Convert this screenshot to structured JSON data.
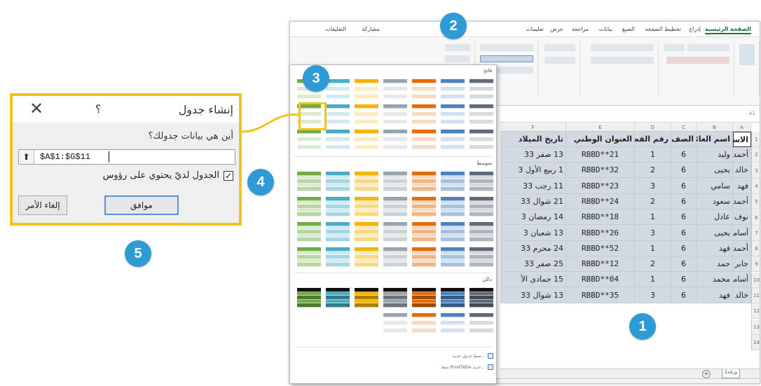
{
  "ribbon": {
    "tabs": [
      "الصفحة الرئيسية",
      "إدراج",
      "تخطيط الصفحة",
      "الصيغ",
      "بيانات",
      "مراجعة",
      "عرض",
      "تعليمات",
      "مشاركة",
      "التعليقات"
    ]
  },
  "sheet": {
    "columns": [
      "A",
      "B",
      "C",
      "D",
      "E",
      "F"
    ],
    "headers": [
      "الاسم",
      "اسم العائلة",
      "الصف",
      "رقم الفصل",
      "العنوان الوطني",
      "تاريخ الميلاد"
    ],
    "rows": [
      [
        "أحمد",
        "وليد",
        "6",
        "1",
        "RBBD**21",
        "13 صفر 33"
      ],
      [
        "خالد",
        "يحيى",
        "6",
        "2",
        "RBBD**32",
        "1 ربيع الأول 3"
      ],
      [
        "فهد",
        "سامي",
        "6",
        "3",
        "RBBD**23",
        "11 رجب 33"
      ],
      [
        "أحمد",
        "سعود",
        "6",
        "2",
        "RBBD**24",
        "21 شوال 33"
      ],
      [
        "نوف",
        "عادل",
        "6",
        "1",
        "RBBD**18",
        "14 رمضان 3"
      ],
      [
        "أسامة",
        "يحيى",
        "6",
        "3",
        "RBBD**26",
        "13 شعبان 3"
      ],
      [
        "أحمد",
        "فهد",
        "6",
        "1",
        "RBBD**52",
        "24 محرم 33"
      ],
      [
        "جابر",
        "حمد",
        "6",
        "2",
        "RBBD**12",
        "25 صفر 33"
      ],
      [
        "أسامة",
        "محمد",
        "6",
        "1",
        "RBBD**04",
        "15 جمادى الأ"
      ],
      [
        "خالد",
        "فهد",
        "6",
        "3",
        "RBBD**35",
        "13 شوال 33"
      ]
    ],
    "row_numbers": [
      "1",
      "2",
      "3",
      "4",
      "5",
      "6",
      "7",
      "8",
      "9",
      "10",
      "11",
      "12",
      "13",
      "14"
    ],
    "sheet_tab": "ورقة1"
  },
  "gallery": {
    "sections": [
      "فاتح",
      "متوسط",
      "داكن"
    ],
    "footer": [
      "نمط جدول جديد...",
      "نمط PivotTable جديد..."
    ]
  },
  "dialog": {
    "title": "إنشاء جدول",
    "help": "؟",
    "close": "✕",
    "question": "أين هي بيانات جدولك؟",
    "range": "$A$1:$G$11",
    "range_button": "⬆",
    "checkbox_checked": true,
    "checkbox_mark": "✓",
    "checkbox_label": "الجدول لديّ يحتوي على رؤوس",
    "ok": "موافق",
    "cancel": "إلغاء الأمر"
  },
  "callouts": [
    "1",
    "2",
    "3",
    "4",
    "5"
  ],
  "colors": {
    "callout": "#2e9ad6",
    "highlight": "#f2c418",
    "excel_green": "#217346",
    "selection": "#d2d9e2"
  }
}
